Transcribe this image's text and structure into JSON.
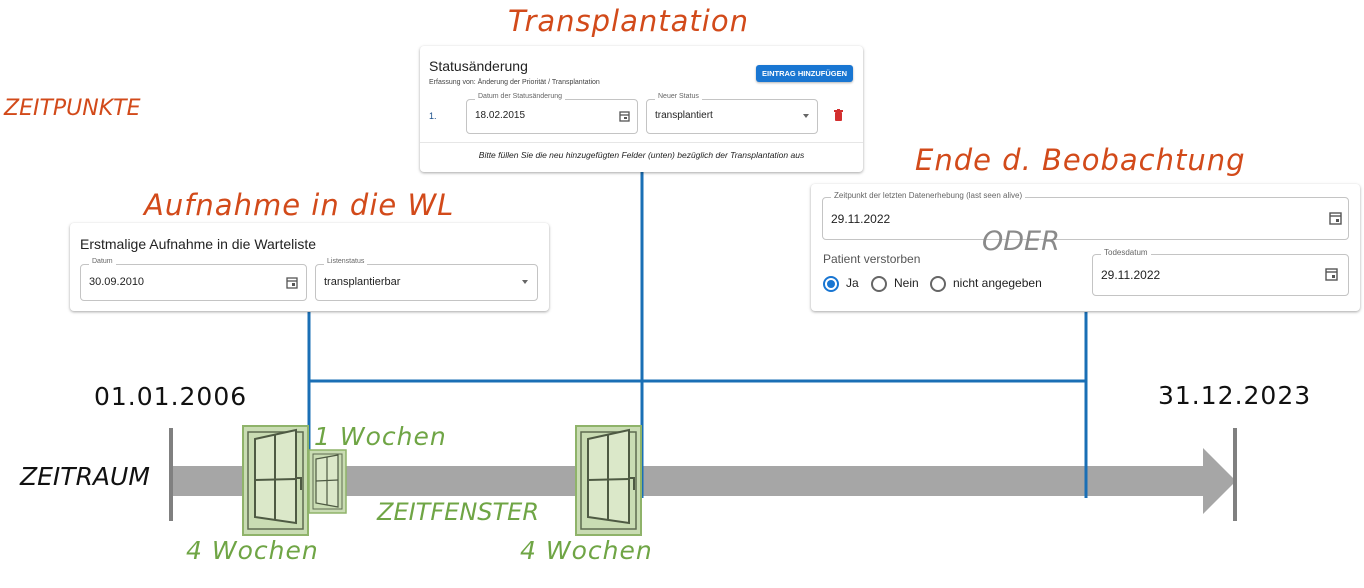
{
  "colors": {
    "label": "#d24a1a",
    "window": "#6fa545",
    "line": "#1a6fb5",
    "arrow": "#a6a6a6",
    "button": "#1976d2"
  },
  "labels": {
    "zeitpunkte": "ZEITPUNKTE",
    "transplantation": "Transplantation",
    "aufnahme": "Aufnahme in die WL",
    "ende": "Ende d. Beobachtung",
    "oder": "ODER",
    "zeitraum": "ZEITRAUM",
    "zeitfenster": "ZEITFENSTER",
    "start_date": "01.01.2006",
    "end_date": "31.12.2023",
    "window_4w_a": "4 Wochen",
    "window_4w_b": "4 Wochen",
    "window_1w": "1 Wochen"
  },
  "status_card": {
    "title": "Statusänderung",
    "subtitle": "Erfassung von: Änderung der Priorität / Transplantation",
    "button": "EINTRAG HINZUFÜGEN",
    "row_index": "1.",
    "date_label": "Datum der Statusänderung",
    "date_value": "18.02.2015",
    "status_label": "Neuer Status",
    "status_value": "transplantiert",
    "note": "Bitte füllen Sie die neu hinzugefügten Felder (unten) bezüglich der Transplantation aus"
  },
  "wl_card": {
    "title": "Erstmalige Aufnahme in die Warteliste",
    "date_label": "Datum",
    "date_value": "30.09.2010",
    "status_label": "Listenstatus",
    "status_value": "transplantierbar"
  },
  "end_card": {
    "last_seen_label": "Zeitpunkt der letzten Datenerhebung (last seen alive)",
    "last_seen_value": "29.11.2022",
    "deceased_label": "Patient verstorben",
    "options": [
      "Ja",
      "Nein",
      "nicht angegeben"
    ],
    "selected": "Ja",
    "death_label": "Todesdatum",
    "death_value": "29.11.2022"
  },
  "icons": {
    "calendar": "calendar-icon",
    "dropdown": "chevron-down-icon",
    "delete": "trash-icon",
    "window": "window-icon"
  }
}
